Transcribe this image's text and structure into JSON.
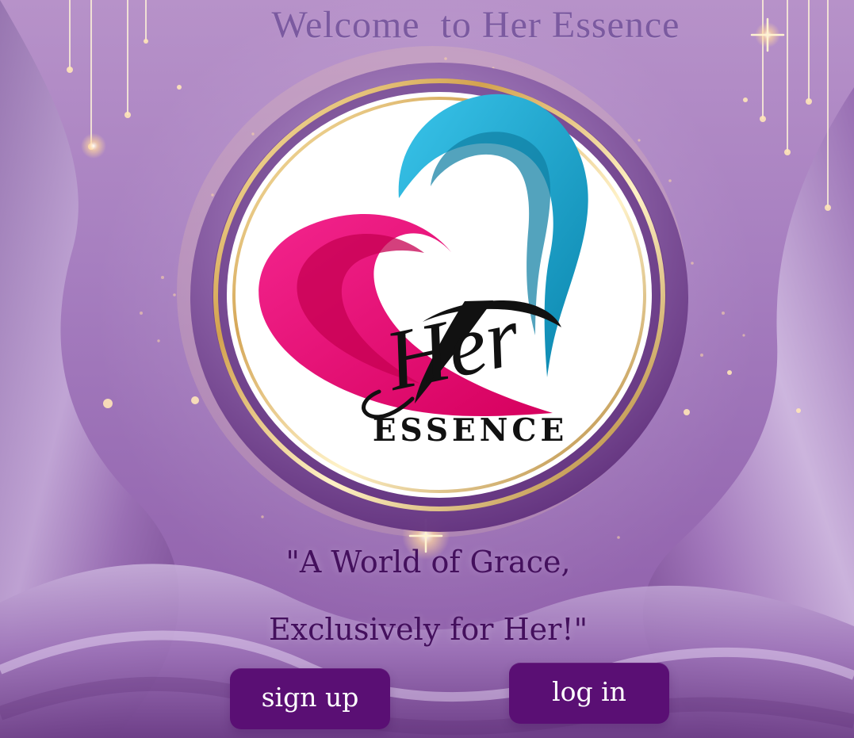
{
  "header": {
    "title": "Welcome  to Her Essence"
  },
  "logo": {
    "script_text": "Her",
    "brand_text": "ESSENCE"
  },
  "tagline": {
    "line1": "\"A World of Grace,",
    "line2": "Exclusively for Her!\""
  },
  "actions": {
    "signup_label": "sign up",
    "login_label": "log in"
  },
  "colors": {
    "background": "#a77fc0",
    "button": "#5a0f74",
    "tagline": "#44105d",
    "heart_pink": "#ec0f79",
    "heart_blue": "#1ea8d1"
  }
}
